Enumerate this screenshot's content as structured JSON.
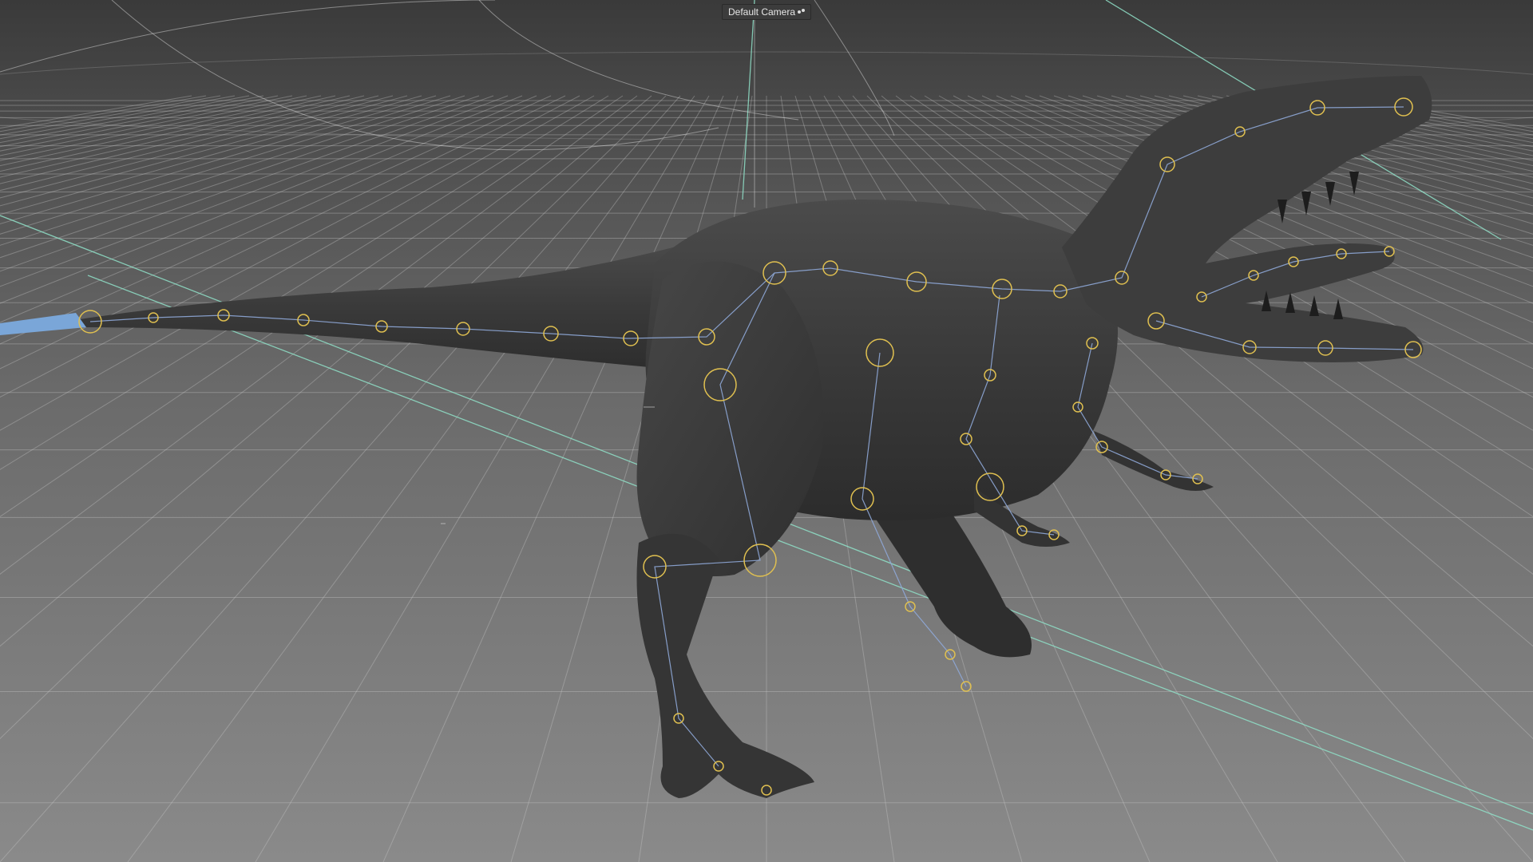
{
  "viewport": {
    "camera_label": "Default Camera",
    "camera_icon": "camera-dots-icon"
  },
  "scene": {
    "object": "t-rex-model",
    "shading": "gray-matte",
    "skeleton_joint_color": "#e0c050",
    "skeleton_bone_color": "#8fa8d8",
    "grid_color": "#c8c8c8",
    "guide_line_color": "#8fe0c8",
    "tail_tip_color": "#7aa6d8"
  }
}
